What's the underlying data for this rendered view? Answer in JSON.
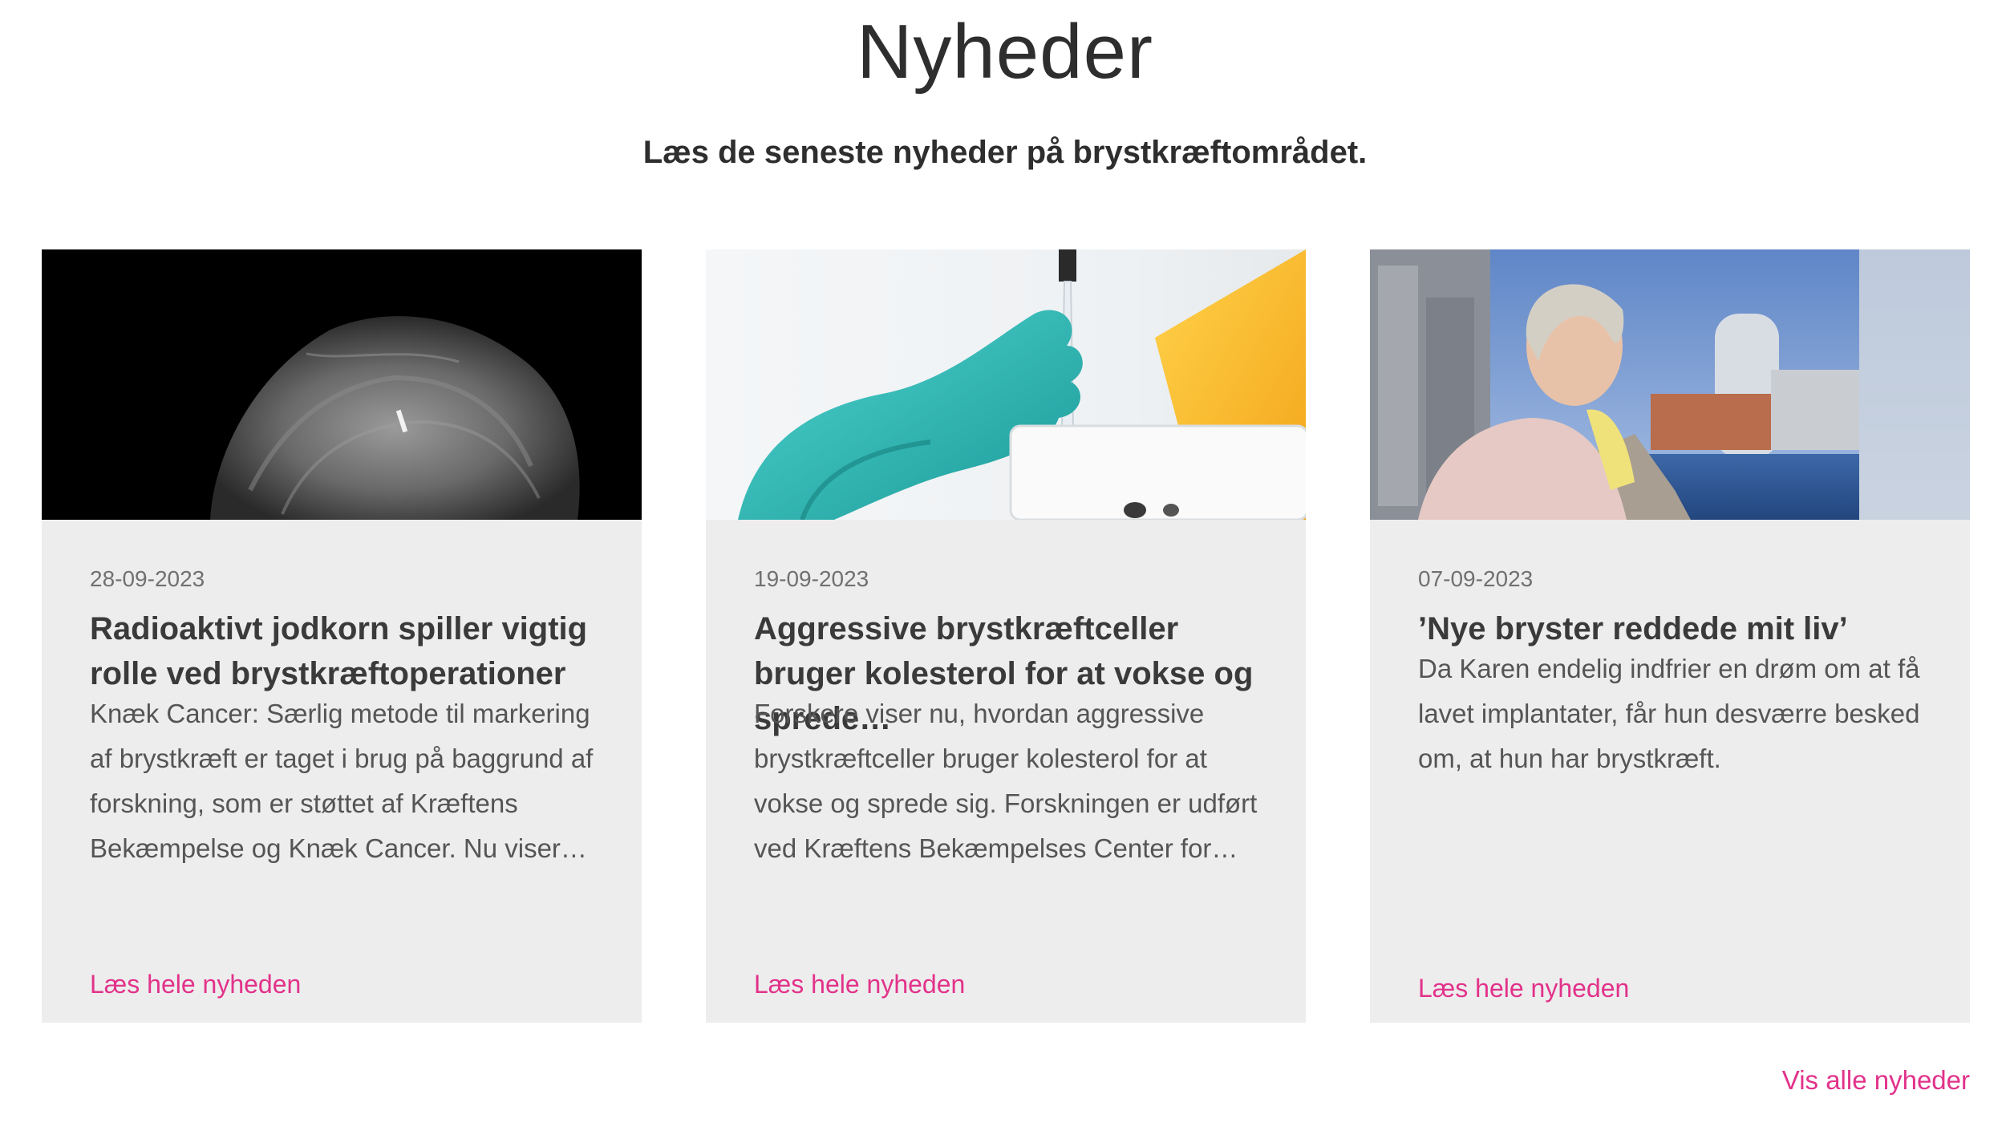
{
  "header": {
    "title": "Nyheder",
    "subtitle": "Læs de seneste nyheder på brystkræftområdet."
  },
  "cards": [
    {
      "date": "28-09-2023",
      "title": "Radioaktivt jodkorn spiller vigtig rolle ved brystkræftoperationer",
      "excerpt": "Knæk Cancer: Særlig metode til markering af brystkræft er taget i brug på baggrund af forskning, som er støttet af Kræftens Bekæmpelse og Knæk Cancer. Nu viser…",
      "link_label": "Læs hele nyheden",
      "image_icon": "mammogram-image"
    },
    {
      "date": "19-09-2023",
      "title": "Aggressive brystkræftceller bruger kolesterol for at vokse og sprede…",
      "excerpt": "Forskere viser nu, hvordan aggressive brystkræftceller bruger kolesterol for at vokse og sprede sig. Forskningen er udført ved Kræftens Bekæmpelses Center for…",
      "link_label": "Læs hele nyheden",
      "image_icon": "lab-glove-pipette-image"
    },
    {
      "date": "07-09-2023",
      "title": "’Nye bryster reddede mit liv’",
      "excerpt": "Da Karen endelig indfrier en drøm om at få lavet implantater, får hun desværre besked om, at hun har brystkræft.",
      "link_label": "Læs hele nyheden",
      "image_icon": "woman-harbour-portrait-image"
    }
  ],
  "footer": {
    "all_news_label": "Vis alle nyheder"
  },
  "colors": {
    "accent": "#e2328a",
    "card_background": "#ededed",
    "text": "#3a3a3a"
  }
}
